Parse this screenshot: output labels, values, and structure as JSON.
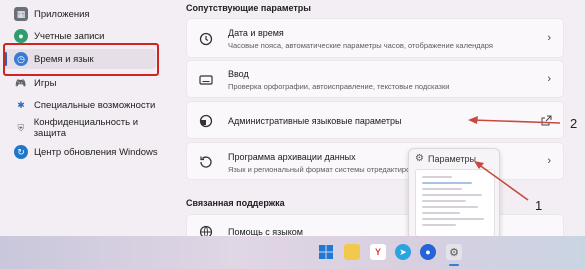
{
  "sidebar": {
    "items": [
      {
        "label": "Приложения",
        "icon": "apps-icon"
      },
      {
        "label": "Учетные записи",
        "icon": "accounts-icon"
      },
      {
        "label": "Время и язык",
        "icon": "time-language-icon"
      },
      {
        "label": "Игры",
        "icon": "games-icon"
      },
      {
        "label": "Специальные возможности",
        "icon": "accessibility-icon"
      },
      {
        "label": "Конфиденциальность и защита",
        "icon": "shield-icon"
      },
      {
        "label": "Центр обновления Windows",
        "icon": "update-icon"
      }
    ]
  },
  "main": {
    "related_title": "Сопутствующие параметры",
    "cards": [
      {
        "title": "Дата и время",
        "subtitle": "Часовые пояса, автоматические параметры часов, отображение календаря"
      },
      {
        "title": "Ввод",
        "subtitle": "Проверка орфографии, автоисправление, текстовые подсказки"
      },
      {
        "title": "Административные языковые параметры",
        "subtitle": ""
      },
      {
        "title": "Программа архивации данных",
        "subtitle": "Язык и региональный формат системы отредактирован"
      }
    ],
    "support_title": "Связанная поддержка",
    "support_item": "Помощь с языком"
  },
  "popup": {
    "title": "Параметры"
  },
  "annotations": {
    "label_1": "1",
    "label_2": "2"
  },
  "colors": {
    "accent": "#2962b8",
    "highlight": "#d22323",
    "arrow": "#c64a3f"
  }
}
